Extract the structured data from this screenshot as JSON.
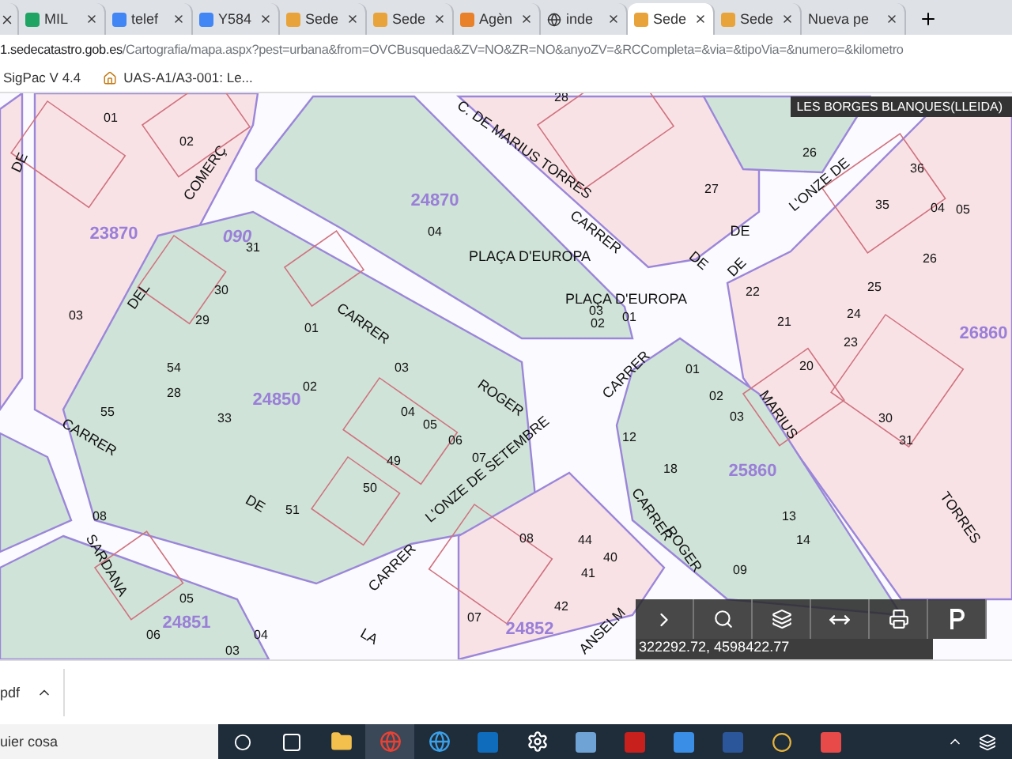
{
  "tabs": [
    {
      "title": "MIL",
      "selected": false
    },
    {
      "title": "telef",
      "selected": false
    },
    {
      "title": "Y584",
      "selected": false
    },
    {
      "title": "Sede",
      "selected": false
    },
    {
      "title": "Sede",
      "selected": false
    },
    {
      "title": "Agèn",
      "selected": false
    },
    {
      "title": "inde",
      "selected": false
    },
    {
      "title": "Sede",
      "selected": true
    },
    {
      "title": "Sede",
      "selected": false
    },
    {
      "title": "Nueva pe",
      "selected": false
    }
  ],
  "address": {
    "host": "1.sedecatastro.gob.es",
    "path": "/Cartografia/mapa.aspx?pest=urbana&from=OVCBusqueda&ZV=NO&ZR=NO&anyoZV=&RCCompleta=&via=&tipoVia=&numero=&kilometro"
  },
  "bookmarks": [
    "SigPac V 4.4",
    "UAS-A1/A3-001: Le..."
  ],
  "map": {
    "municipality": "LES BORGES BLANQUES(LLEIDA)",
    "blocks": [
      "23870",
      "24870",
      "24850",
      "25860",
      "26860",
      "24851",
      "24852",
      "090"
    ],
    "places": [
      "PLAÇA D'EUROPA",
      "PLAÇA D'EUROPA"
    ],
    "streets": [
      "C. DE MARIUS TORRES",
      "CARRER",
      "DE",
      "L'ONZE DE",
      "DE",
      "COMERÇ",
      "DEL",
      "DE",
      "CARRER",
      "ROGER",
      "CARRER",
      "DE",
      "L'ONZE DE SETEMBRE",
      "CARRER",
      "CARRER",
      "MARIUS",
      "TORRES",
      "LA",
      "SARDANA",
      "CARRER",
      "ROGER",
      "ANSELM",
      "DE"
    ],
    "parcels": [
      "28",
      "01",
      "02",
      "26",
      "36",
      "27",
      "35",
      "04",
      "05",
      "04",
      "31",
      "26",
      "30",
      "22",
      "25",
      "03",
      "29",
      "01",
      "03",
      "02",
      "01",
      "21",
      "24",
      "23",
      "54",
      "03",
      "01",
      "20",
      "28",
      "02",
      "02",
      "55",
      "33",
      "04",
      "05",
      "03",
      "30",
      "06",
      "12",
      "31",
      "49",
      "07",
      "18",
      "50",
      "08",
      "51",
      "13",
      "08",
      "44",
      "14",
      "40",
      "41",
      "09",
      "05",
      "42",
      "07",
      "06",
      "04",
      "03"
    ],
    "coordinates": "322292.72, 4598422.77"
  },
  "download": {
    "file": "pdf"
  },
  "taskbar": {
    "search": "uier cosa"
  }
}
